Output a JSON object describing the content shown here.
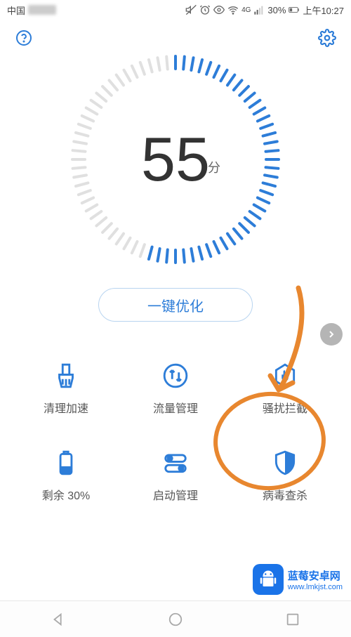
{
  "statusBar": {
    "carrier": "中国",
    "battery": "30%",
    "time": "上午10:27",
    "network": "4G"
  },
  "gauge": {
    "score": "55",
    "unit": "分",
    "progress": 55
  },
  "optimizeButton": {
    "label": "一键优化"
  },
  "grid": {
    "items": [
      {
        "label": "清理加速",
        "icon": "broom"
      },
      {
        "label": "流量管理",
        "icon": "data-arrows"
      },
      {
        "label": "骚扰拦截",
        "icon": "block-hand"
      },
      {
        "label": "剩余 30%",
        "icon": "battery"
      },
      {
        "label": "启动管理",
        "icon": "toggles"
      },
      {
        "label": "病毒查杀",
        "icon": "shield"
      }
    ]
  },
  "colors": {
    "accent": "#2d7dd8",
    "annotation": "#e8872f"
  },
  "watermark": {
    "title": "蓝莓安卓网",
    "url": "www.lmkjst.com"
  }
}
